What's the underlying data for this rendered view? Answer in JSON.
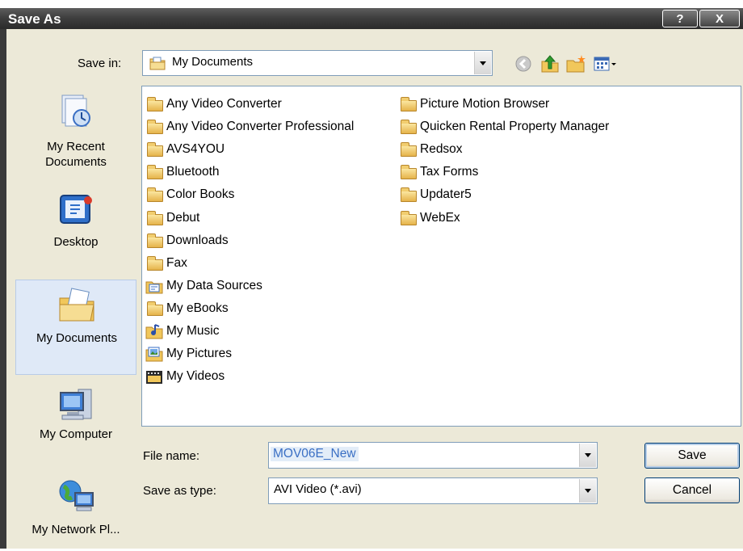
{
  "window": {
    "title": "Save As",
    "help_label": "?",
    "close_label": "X"
  },
  "save_in": {
    "label": "Save in:",
    "value": "My Documents"
  },
  "toolbar": {
    "back_icon": "back-arrow-icon",
    "up_icon": "up-folder-icon",
    "new_folder_icon": "new-folder-icon",
    "views_icon": "views-menu-icon"
  },
  "places": [
    {
      "label": "My Recent Documents",
      "icon": "recent-documents-icon"
    },
    {
      "label": "Desktop",
      "icon": "desktop-icon"
    },
    {
      "label": "My Documents",
      "icon": "my-documents-icon"
    },
    {
      "label": "My Computer",
      "icon": "my-computer-icon"
    },
    {
      "label": "My Network Pl...",
      "icon": "network-places-icon"
    }
  ],
  "files": {
    "column1": [
      {
        "name": "Any Video Converter",
        "icon": "folder"
      },
      {
        "name": "Any Video Converter Professional",
        "icon": "folder"
      },
      {
        "name": "AVS4YOU",
        "icon": "folder"
      },
      {
        "name": "Bluetooth",
        "icon": "folder"
      },
      {
        "name": "Color Books",
        "icon": "folder"
      },
      {
        "name": "Debut",
        "icon": "folder"
      },
      {
        "name": "Downloads",
        "icon": "folder"
      },
      {
        "name": "Fax",
        "icon": "folder"
      },
      {
        "name": "My Data Sources",
        "icon": "data-sources-folder"
      },
      {
        "name": "My eBooks",
        "icon": "folder"
      },
      {
        "name": "My Music",
        "icon": "music-folder"
      },
      {
        "name": "My Pictures",
        "icon": "pictures-folder"
      },
      {
        "name": "My Videos",
        "icon": "videos-folder"
      }
    ],
    "column2": [
      {
        "name": "Picture Motion Browser",
        "icon": "folder"
      },
      {
        "name": "Quicken Rental Property Manager",
        "icon": "folder"
      },
      {
        "name": "Redsox",
        "icon": "folder"
      },
      {
        "name": "Tax Forms",
        "icon": "folder"
      },
      {
        "name": "Updater5",
        "icon": "folder"
      },
      {
        "name": "WebEx",
        "icon": "folder"
      }
    ]
  },
  "file_name": {
    "label": "File name:",
    "value": "MOV06E_New"
  },
  "save_as_type": {
    "label": "Save as type:",
    "value": "AVI Video (*.avi)"
  },
  "buttons": {
    "save": "Save",
    "cancel": "Cancel"
  },
  "colors": {
    "title_bar": "#3f3f3f",
    "dialog_bg": "#ece9d8",
    "selection_blue": "#3a6fc4",
    "folder_yellow": "#e5b34a"
  }
}
